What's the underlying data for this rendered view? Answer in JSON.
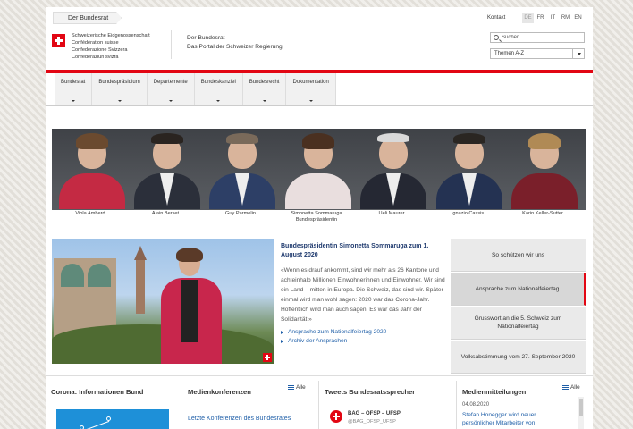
{
  "topbar": {
    "breadcrumb": "Der Bundesrat",
    "contact": "Kontakt",
    "languages": [
      "DE",
      "FR",
      "IT",
      "RM",
      "EN"
    ],
    "active_language": "DE"
  },
  "header": {
    "confederation_lines": [
      "Schweizerische Eidgenossenschaft",
      "Confédération suisse",
      "Confederazione Svizzera",
      "Confederaziun svizra"
    ],
    "portal_title": "Der Bundesrat",
    "portal_subtitle": "Das Portal der Schweizer Regierung",
    "search_placeholder": "Suchen",
    "topics_select": "Themen A-Z"
  },
  "nav": {
    "items": [
      "Bundesrat",
      "Bundespräsidium",
      "Departemente",
      "Bundeskanzlei",
      "Bundesrecht",
      "Dokumentation"
    ]
  },
  "council": {
    "members": [
      {
        "name": "Viola Amherd",
        "role": ""
      },
      {
        "name": "Alain Berset",
        "role": ""
      },
      {
        "name": "Guy Parmelin",
        "role": ""
      },
      {
        "name": "Simonetta Sommaruga",
        "role": "Bundespräsidentin"
      },
      {
        "name": "Ueli Maurer",
        "role": ""
      },
      {
        "name": "Ignazio Cassis",
        "role": ""
      },
      {
        "name": "Karin Keller-Sutter",
        "role": ""
      }
    ]
  },
  "feature": {
    "title": "Bundespräsidentin Simonetta Sommaruga zum 1. August 2020",
    "text": "«Wenn es drauf ankommt, sind wir mehr als 26 Kantone und achteinhalb Millionen Einwohnerinnen und Einwohner. Wir sind ein Land – mitten in Europa. Die Schweiz, das sind wir. Später einmal wird man wohl sagen: 2020 war das Corona-Jahr. Hoffentlich wird man auch sagen: Es war das Jahr der Solidarität.»",
    "links": [
      "Ansprache zum Nationalfeiertag 2020",
      "Archiv der Ansprachen"
    ]
  },
  "panels": [
    {
      "label": "So schützen wir uns",
      "active": false
    },
    {
      "label": "Ansprache zum Nationalfeiertag",
      "active": true
    },
    {
      "label": "Grusswort an die 5. Schweiz zum Nationalfeiertag",
      "active": false
    },
    {
      "label": "Volksabstimmung vom 27. September 2020",
      "active": false
    }
  ],
  "bottom": {
    "corona_title": "Corona: Informationen Bund",
    "media_conf_title": "Medienkonferenzen",
    "all_label": "Alle",
    "conf_link": "Letzte Konferenzen des Bundesrates",
    "tweets_title": "Tweets Bundesratssprecher",
    "tweet_name": "BAG – OFSP – UFSP",
    "tweet_handle": "@BAG_OFSP_UFSP",
    "mm_title": "Medienmitteilungen",
    "mm_date": "04.08.2020",
    "mm_text": "Stefan Honegger wird neuer persönlicher Mitarbeiter von"
  },
  "colors": {
    "swiss_red": "#e20613",
    "link_blue": "#1f5fa8",
    "title_blue": "#1f3a6e"
  }
}
